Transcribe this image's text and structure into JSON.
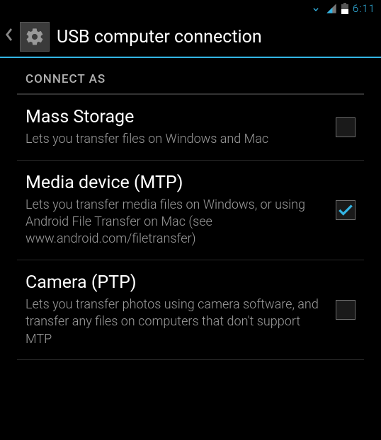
{
  "status": {
    "time": "6:11"
  },
  "header": {
    "title": "USB computer connection"
  },
  "section": {
    "label": "CONNECT AS"
  },
  "options": [
    {
      "title": "Mass Storage",
      "subtitle": "Lets you transfer files on Windows and Mac",
      "checked": false
    },
    {
      "title": "Media device (MTP)",
      "subtitle": "Lets you transfer media files on Windows, or using Android File Transfer on Mac (see www.android.com/filetransfer)",
      "checked": true
    },
    {
      "title": "Camera (PTP)",
      "subtitle": "Lets you transfer photos using camera software, and transfer any files on computers that don't support MTP",
      "checked": false
    }
  ],
  "colors": {
    "accent": "#33b5e5"
  }
}
